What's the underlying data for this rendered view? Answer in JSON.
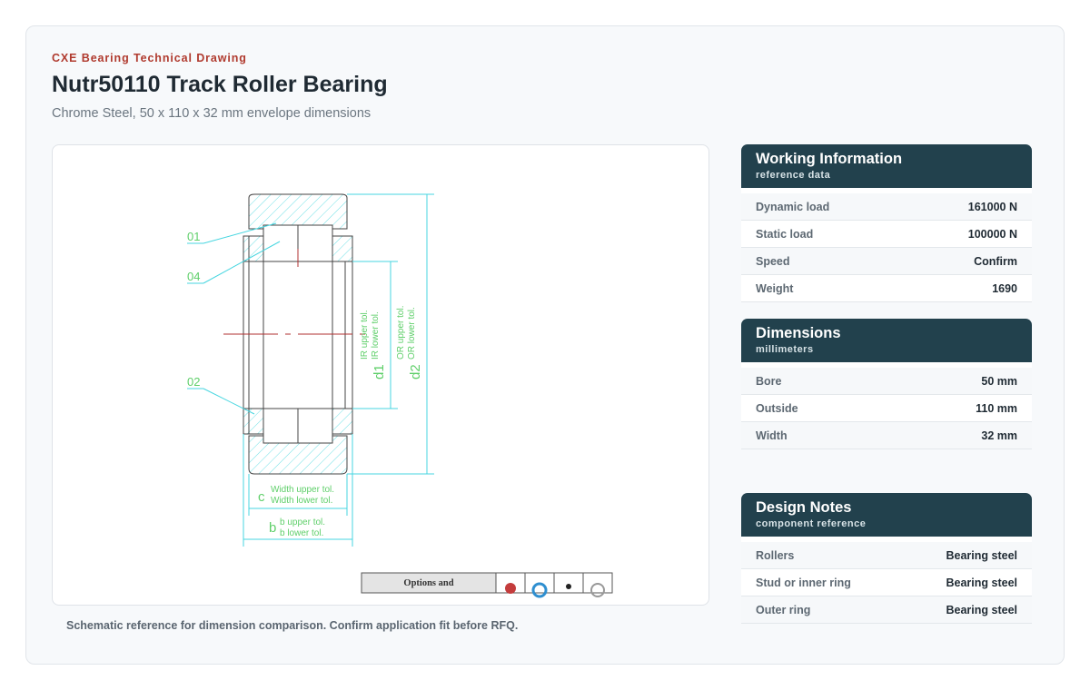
{
  "header": {
    "eyebrow": "CXE Bearing Technical Drawing",
    "title": "Nutr50110 Track Roller Bearing",
    "subtitle": "Chrome Steel, 50 x 110 x 32 mm envelope dimensions"
  },
  "drawing": {
    "labels": {
      "part_01": "01",
      "part_04": "04",
      "part_02": "02",
      "d1": "d1",
      "ir_upper": "IR upper tol.",
      "ir_lower": "IR lower tol.",
      "d2": "d2",
      "or_upper": "OR upper tol.",
      "or_lower": "OR lower tol.",
      "c": "c",
      "width_upper": "Width upper tol.",
      "width_lower": "Width lower tol.",
      "b": "b",
      "b_upper": "b upper tol.",
      "b_lower": "b lower tol.",
      "options": "Options and"
    },
    "caption": "Schematic reference for dimension comparison. Confirm application fit before RFQ."
  },
  "panels": {
    "working": {
      "title": "Working Information",
      "subtitle": "reference data",
      "rows": [
        {
          "key": "Dynamic load",
          "value": "161000 N"
        },
        {
          "key": "Static load",
          "value": "100000 N"
        },
        {
          "key": "Speed",
          "value": "Confirm"
        },
        {
          "key": "Weight",
          "value": "1690"
        }
      ]
    },
    "dimensions": {
      "title": "Dimensions",
      "subtitle": "millimeters",
      "rows": [
        {
          "key": "Bore",
          "value": "50 mm"
        },
        {
          "key": "Outside",
          "value": "110 mm"
        },
        {
          "key": "Width",
          "value": "32 mm"
        }
      ]
    },
    "notes": {
      "title": "Design Notes",
      "subtitle": "component reference",
      "rows": [
        {
          "key": "Rollers",
          "value": "Bearing steel"
        },
        {
          "key": "Stud or inner ring",
          "value": "Bearing steel"
        },
        {
          "key": "Outer ring",
          "value": "Bearing steel"
        }
      ]
    }
  },
  "colors": {
    "accent": "#b03a2e",
    "panel_header": "#22414d",
    "drawing_lines": "#333333",
    "dimension_lines": "#47d6e0",
    "labels": "#5fcf6a"
  }
}
